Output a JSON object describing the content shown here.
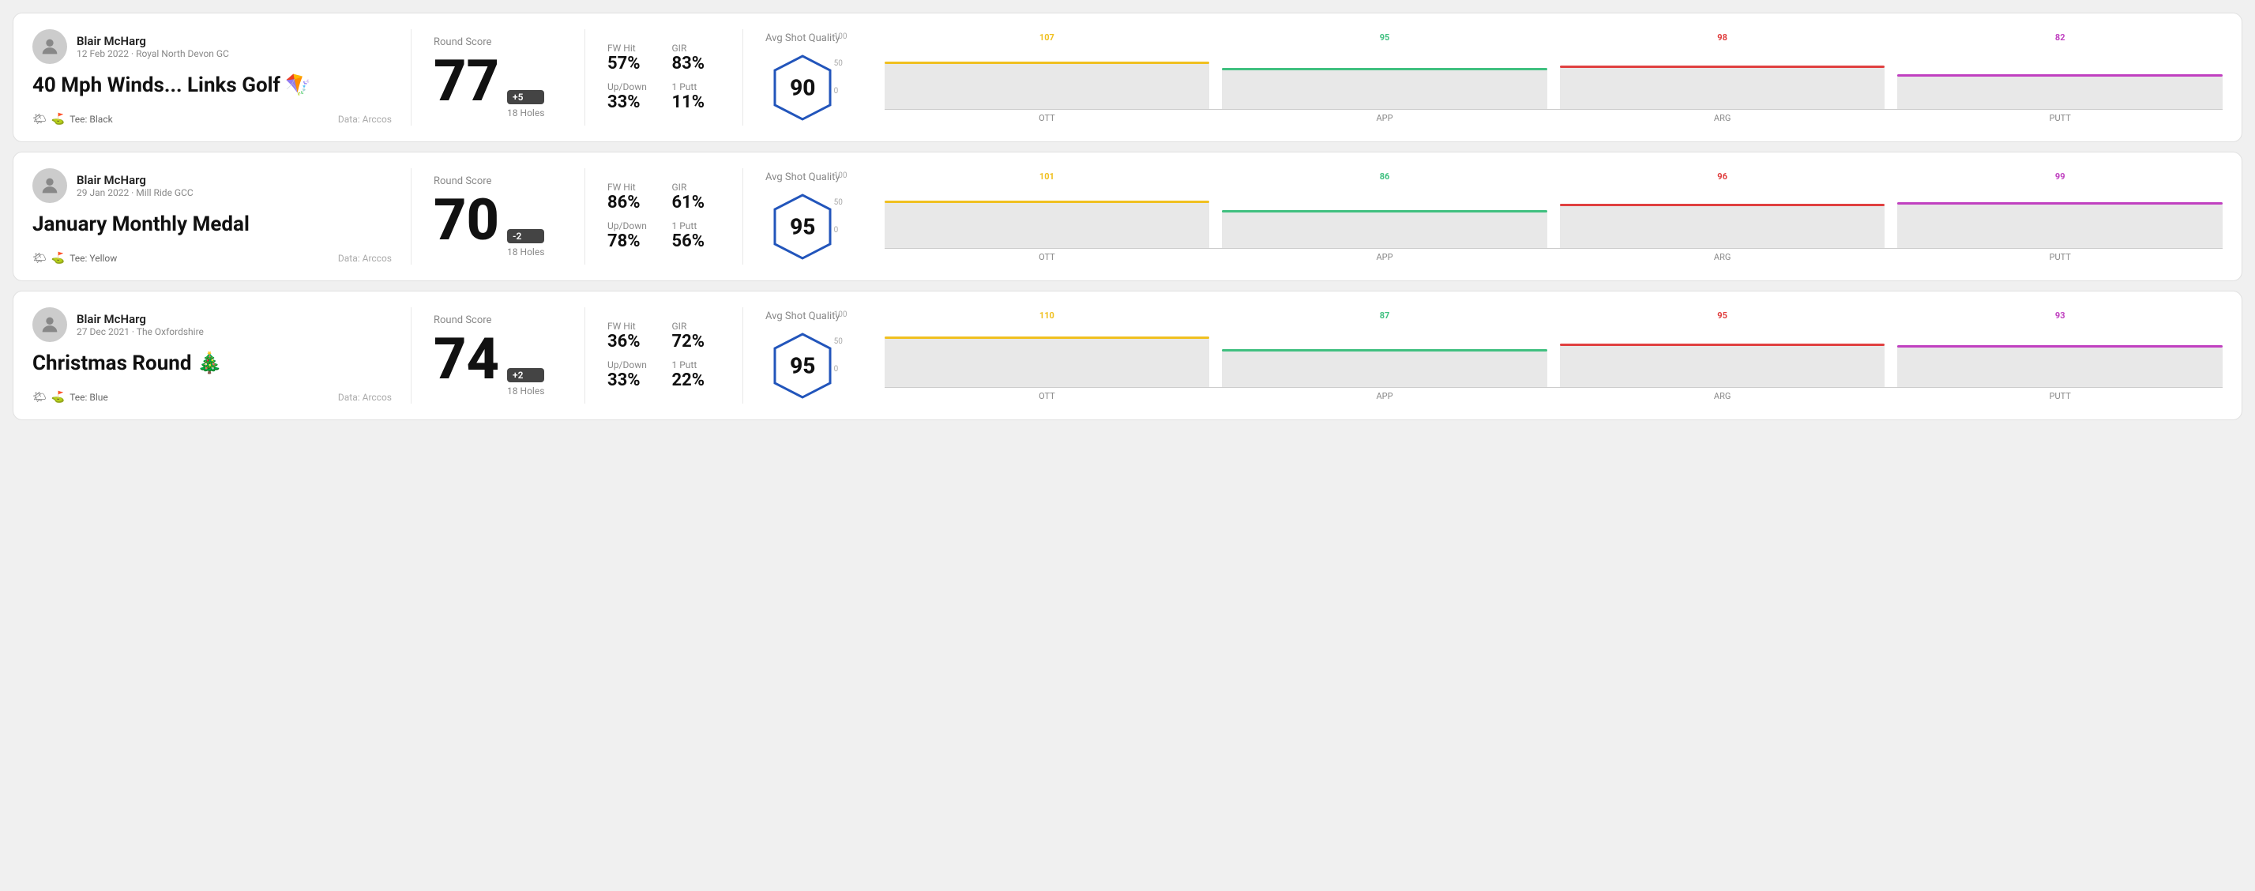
{
  "rounds": [
    {
      "id": "round1",
      "user": {
        "name": "Blair McHarg",
        "meta": "12 Feb 2022 · Royal North Devon GC"
      },
      "title": "40 Mph Winds... Links Golf",
      "titleEmoji": "🪁",
      "tee": "Black",
      "dataSource": "Data: Arccos",
      "score": "77",
      "scoreDiff": "+5",
      "holes": "18 Holes",
      "fwHit": "57%",
      "gir": "83%",
      "upDown": "33%",
      "onePutt": "11%",
      "avgShotQuality": "90",
      "chart": {
        "label": "Avg Shot Quality",
        "bars": [
          {
            "label": "OTT",
            "value": 107,
            "color": "#f0c020",
            "heightPct": 75
          },
          {
            "label": "APP",
            "value": 95,
            "color": "#40c080",
            "heightPct": 65
          },
          {
            "label": "ARG",
            "value": 98,
            "color": "#e04040",
            "heightPct": 68
          },
          {
            "label": "PUTT",
            "value": 82,
            "color": "#c040c0",
            "heightPct": 55
          }
        ]
      }
    },
    {
      "id": "round2",
      "user": {
        "name": "Blair McHarg",
        "meta": "29 Jan 2022 · Mill Ride GCC"
      },
      "title": "January Monthly Medal",
      "titleEmoji": "",
      "tee": "Yellow",
      "dataSource": "Data: Arccos",
      "score": "70",
      "scoreDiff": "-2",
      "holes": "18 Holes",
      "fwHit": "86%",
      "gir": "61%",
      "upDown": "78%",
      "onePutt": "56%",
      "avgShotQuality": "95",
      "chart": {
        "label": "Avg Shot Quality",
        "bars": [
          {
            "label": "OTT",
            "value": 101,
            "color": "#f0c020",
            "heightPct": 75
          },
          {
            "label": "APP",
            "value": 86,
            "color": "#40c080",
            "heightPct": 60
          },
          {
            "label": "ARG",
            "value": 96,
            "color": "#e04040",
            "heightPct": 70
          },
          {
            "label": "PUTT",
            "value": 99,
            "color": "#c040c0",
            "heightPct": 72
          }
        ]
      }
    },
    {
      "id": "round3",
      "user": {
        "name": "Blair McHarg",
        "meta": "27 Dec 2021 · The Oxfordshire"
      },
      "title": "Christmas Round",
      "titleEmoji": "🎄",
      "tee": "Blue",
      "dataSource": "Data: Arccos",
      "score": "74",
      "scoreDiff": "+2",
      "holes": "18 Holes",
      "fwHit": "36%",
      "gir": "72%",
      "upDown": "33%",
      "onePutt": "22%",
      "avgShotQuality": "95",
      "chart": {
        "label": "Avg Shot Quality",
        "bars": [
          {
            "label": "OTT",
            "value": 110,
            "color": "#f0c020",
            "heightPct": 80
          },
          {
            "label": "APP",
            "value": 87,
            "color": "#40c080",
            "heightPct": 60
          },
          {
            "label": "ARG",
            "value": 95,
            "color": "#e04040",
            "heightPct": 68
          },
          {
            "label": "PUTT",
            "value": 93,
            "color": "#c040c0",
            "heightPct": 66
          }
        ]
      }
    }
  ],
  "labels": {
    "roundScore": "Round Score",
    "fwHit": "FW Hit",
    "gir": "GIR",
    "upDown": "Up/Down",
    "onePutt": "1 Putt",
    "avgShotQuality": "Avg Shot Quality",
    "teePrefix": "Tee:",
    "yAxis": {
      "top": "100",
      "mid": "50",
      "bottom": "0"
    }
  }
}
